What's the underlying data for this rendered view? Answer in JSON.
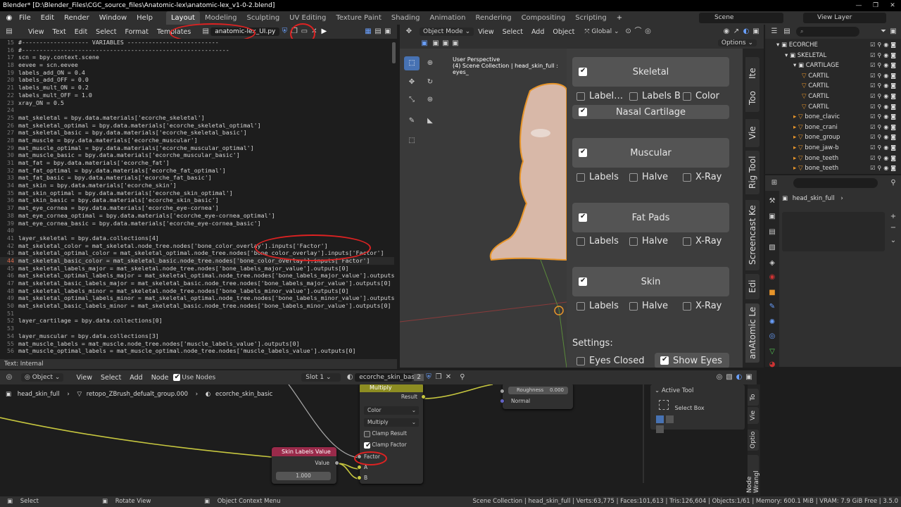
{
  "title_bar": {
    "text": "Blender* [D:\\Blender_Files\\CGC_source_files\\Anatomic-lex\\anatomic-lex_v1-0-2.blend]"
  },
  "menu": {
    "items": [
      "File",
      "Edit",
      "Render",
      "Window",
      "Help"
    ],
    "workspaces": [
      "Layout",
      "Modeling",
      "Sculpting",
      "UV Editing",
      "Texture Paint",
      "Shading",
      "Animation",
      "Rendering",
      "Compositing",
      "Scripting"
    ],
    "scene": "Scene",
    "view_layer": "View Layer"
  },
  "text_editor": {
    "menus": [
      "View",
      "Text",
      "Edit",
      "Select",
      "Format",
      "Templates"
    ],
    "file_name": "anatomic-lex_UI.py",
    "footer": "Text: Internal",
    "lines": [
      {
        "n": "15",
        "t": "#------------------- VARIABLES --------------------------"
      },
      {
        "n": "16",
        "t": "#-----------------------------------------------------------"
      },
      {
        "n": "17",
        "t": "scn = bpy.context.scene"
      },
      {
        "n": "18",
        "t": "eevee = scn.eevee"
      },
      {
        "n": "19",
        "t": "labels_add_ON = 0.4"
      },
      {
        "n": "20",
        "t": "labels_add_OFF = 0.0"
      },
      {
        "n": "21",
        "t": "labels_mult_ON = 0.2"
      },
      {
        "n": "22",
        "t": "labels_mult_OFF = 1.0"
      },
      {
        "n": "23",
        "t": "xray_ON = 0.5"
      },
      {
        "n": "24",
        "t": ""
      },
      {
        "n": "25",
        "t": "mat_skeletal = bpy.data.materials['ecorche_skeletal']"
      },
      {
        "n": "26",
        "t": "mat_skeletal_optimal = bpy.data.materials['ecorche_skeletal_optimal']"
      },
      {
        "n": "27",
        "t": "mat_skeletal_basic = bpy.data.materials['ecorche_skeletal_basic']"
      },
      {
        "n": "28",
        "t": "mat_muscle = bpy.data.materials['ecorche_muscular']"
      },
      {
        "n": "29",
        "t": "mat_muscle_optimal = bpy.data.materials['ecorche_muscular_optimal']"
      },
      {
        "n": "30",
        "t": "mat_muscle_basic = bpy.data.materials['ecorche_muscular_basic']"
      },
      {
        "n": "31",
        "t": "mat_fat = bpy.data.materials['ecorche_fat']"
      },
      {
        "n": "32",
        "t": "mat_fat_optimal = bpy.data.materials['ecorche_fat_optimal']"
      },
      {
        "n": "33",
        "t": "mat_fat_basic = bpy.data.materials['ecorche_fat_basic']"
      },
      {
        "n": "34",
        "t": "mat_skin = bpy.data.materials['ecorche_skin']"
      },
      {
        "n": "35",
        "t": "mat_skin_optimal = bpy.data.materials['ecorche_skin_optimal']"
      },
      {
        "n": "36",
        "t": "mat_skin_basic = bpy.data.materials['ecorche_skin_basic']"
      },
      {
        "n": "37",
        "t": "mat_eye_cornea = bpy.data.materials['ecorche_eye-cornea']"
      },
      {
        "n": "38",
        "t": "mat_eye_cornea_optimal = bpy.data.materials['ecorche_eye-cornea_optimal']"
      },
      {
        "n": "39",
        "t": "mat_eye_cornea_basic = bpy.data.materials['ecorche_eye-cornea_basic']"
      },
      {
        "n": "40",
        "t": ""
      },
      {
        "n": "41",
        "t": "layer_skeletal = bpy.data.collections[4]"
      },
      {
        "n": "42",
        "t": "mat_skeletal_color = mat_skeletal.node_tree.nodes['bone_color_overlay'].inputs['Factor']"
      },
      {
        "n": "43",
        "t": "mat_skeletal_optimal_color = mat_skeletal_optimal.node_tree.nodes['bone_color_overlay'].inputs['Factor']"
      },
      {
        "n": "44",
        "t": "mat_skeletal_basic_color = mat_skeletal_basic.node_tree.nodes['bone_color_overlay'].inputs['Factor']"
      },
      {
        "n": "45",
        "t": "mat_skeletal_labels_major = mat_skeletal.node_tree.nodes['bone_labels_major_value'].outputs[0]"
      },
      {
        "n": "46",
        "t": "mat_skeletal_optimal_labels_major = mat_skeletal_optimal.node_tree.nodes['bone_labels_major_value'].outputs[0]"
      },
      {
        "n": "47",
        "t": "mat_skeletal_basic_labels_major = mat_skeletal_basic.node_tree.nodes['bone_labels_major_value'].outputs[0]"
      },
      {
        "n": "48",
        "t": "mat_skeletal_labels_minor = mat_skeletal.node_tree.nodes['bone_labels_minor_value'].outputs[0]"
      },
      {
        "n": "49",
        "t": "mat_skeletal_optimal_labels_minor = mat_skeletal_optimal.node_tree.nodes['bone_labels_minor_value'].outputs[0]"
      },
      {
        "n": "50",
        "t": "mat_skeletal_basic_labels_minor = mat_skeletal_basic.node_tree.nodes['bone_labels_minor_value'].outputs[0]"
      },
      {
        "n": "51",
        "t": ""
      },
      {
        "n": "52",
        "t": "layer_cartilage = bpy.data.collections[0]"
      },
      {
        "n": "53",
        "t": ""
      },
      {
        "n": "54",
        "t": "layer_muscular = bpy.data.collections[3]"
      },
      {
        "n": "55",
        "t": "mat_muscle_labels = mat_muscle.node_tree.nodes['muscle_labels_value'].outputs[0]"
      },
      {
        "n": "56",
        "t": "mat_muscle_optimal_labels = mat_muscle_optimal.node_tree.nodes['muscle_labels_value'].outputs[0]"
      }
    ]
  },
  "viewport": {
    "mode": "Object Mode",
    "menus": [
      "View",
      "Select",
      "Add",
      "Object"
    ],
    "orientation": "Global",
    "options": "Options",
    "overlay_line1": "User Perspective",
    "overlay_line2": "(4) Scene Collection | head_skin_full : eyes_"
  },
  "addon_panel": {
    "skeletal": {
      "label": "Skeletal",
      "sub": [
        {
          "label": "Label…",
          "on": false
        },
        {
          "label": "Labels B",
          "on": false
        },
        {
          "label": "Color",
          "on": false
        }
      ],
      "nasal": "Nasal Cartilage"
    },
    "muscular": {
      "label": "Muscular",
      "sub": [
        {
          "label": "Labels"
        },
        {
          "label": "Halve"
        },
        {
          "label": "X-Ray"
        }
      ]
    },
    "fatpads": {
      "label": "Fat Pads",
      "sub": [
        {
          "label": "Labels"
        },
        {
          "label": "Halve"
        },
        {
          "label": "X-Ray"
        }
      ]
    },
    "skin": {
      "label": "Skin",
      "sub": [
        {
          "label": "Labels"
        },
        {
          "label": "Halve"
        },
        {
          "label": "X-Ray"
        }
      ]
    },
    "settings_label": "Settings:",
    "eyes_closed": "Eyes Closed",
    "show_eyes": "Show Eyes",
    "tabs": [
      "Ite",
      "Too",
      "Vie",
      "Rig Tool",
      "Screencast Ke",
      "Edi",
      "anAtomic Le"
    ]
  },
  "outliner": {
    "rows": [
      {
        "indent": 0,
        "label": "ECORCHE"
      },
      {
        "indent": 1,
        "label": "SKELETAL"
      },
      {
        "indent": 2,
        "label": "CARTILAGE"
      },
      {
        "indent": 3,
        "label": "CARTIL"
      },
      {
        "indent": 3,
        "label": "CARTIL"
      },
      {
        "indent": 3,
        "label": "CARTIL"
      },
      {
        "indent": 3,
        "label": "CARTIL"
      },
      {
        "indent": 2,
        "label": "bone_clavic"
      },
      {
        "indent": 2,
        "label": "bone_crani"
      },
      {
        "indent": 2,
        "label": "bone_group"
      },
      {
        "indent": 2,
        "label": "bone_jaw-b"
      },
      {
        "indent": 2,
        "label": "bone_teeth"
      },
      {
        "indent": 2,
        "label": "bone_teeth"
      }
    ]
  },
  "properties": {
    "object_name": "head_skin_full"
  },
  "node_editor": {
    "object_menu": "Object",
    "menus": [
      "View",
      "Select",
      "Add",
      "Node"
    ],
    "use_nodes": "Use Nodes",
    "slot": "Slot 1",
    "material": "ecorche_skin_basic",
    "users": "2",
    "breadcrumb": [
      "head_skin_full",
      "retopo_ZBrush_defualt_group.000",
      "ecorche_skin_basic"
    ],
    "multiply_node": {
      "title": "Multiply",
      "result": "Result",
      "type": "Color",
      "blend": "Multiply",
      "clamp_result": "Clamp Result",
      "clamp_factor": "Clamp Factor",
      "factor": "Factor",
      "a": "A",
      "b": "B"
    },
    "value_node": {
      "title": "Skin Labels Value",
      "value_label": "Value",
      "value": "1.000"
    },
    "bsdf": {
      "roughness": "Roughness",
      "roughness_val": "0.000",
      "normal": "Normal"
    },
    "active_tool": {
      "title": "Active Tool",
      "tool": "Select Box"
    },
    "tabs": [
      "To",
      "Vie",
      "Optio",
      "Node Wrangl"
    ]
  },
  "status": {
    "select": "Select",
    "rotate": "Rotate View",
    "context": "Object Context Menu",
    "info": "Scene Collection | head_skin_full | Verts:63,775 | Faces:101,613 | Tris:126,604 | Objects:1/61 | Memory: 600.1 MiB | VRAM: 7.9 GiB Free | 3.5.0"
  }
}
